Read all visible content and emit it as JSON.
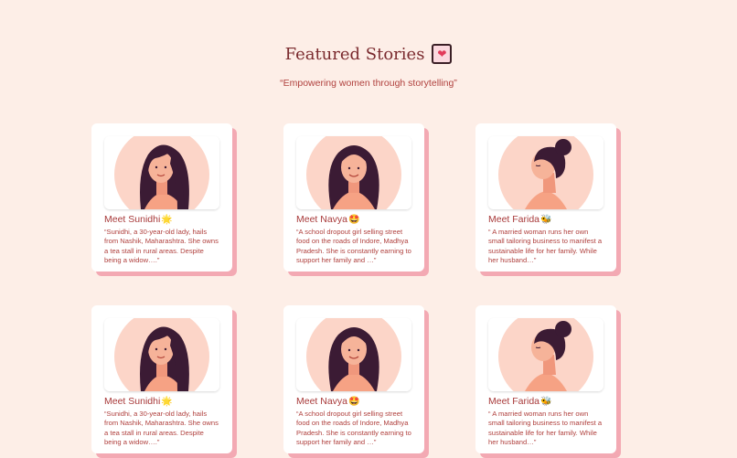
{
  "header": {
    "title": "Featured Stories",
    "subtitle": "“Empowering women through storytelling”",
    "title_icon": "heart-icon"
  },
  "cards": [
    {
      "name": "Meet Sunidhi",
      "emoji": "🌟",
      "avatar": "woman-long-hair-icon",
      "description": "“Sunidhi, a 30-year-old lady, hails from Nashik, Maharashtra. She owns a tea stall in rural areas. Despite being a widow….”"
    },
    {
      "name": "Meet Navya",
      "emoji": "🤩",
      "avatar": "woman-smiling-icon",
      "description": "“A school dropout girl selling street food on the roads of Indore, Madhya Pradesh. She is constantly earning to support her family and …”"
    },
    {
      "name": "Meet Farida",
      "emoji": "🐝",
      "avatar": "woman-bun-profile-icon",
      "description": "“ A married woman runs her own small tailoring business to manifest a sustainable life for her family. While her husband…”"
    },
    {
      "name": "Meet Sunidhi",
      "emoji": "🌟",
      "avatar": "woman-long-hair-icon",
      "description": "“Sunidhi, a 30-year-old lady, hails from Nashik, Maharashtra. She owns a tea stall in rural areas. Despite being a widow….”"
    },
    {
      "name": "Meet Navya",
      "emoji": "🤩",
      "avatar": "woman-smiling-icon",
      "description": "“A school dropout girl selling street food on the roads of Indore, Madhya Pradesh. She is constantly earning to support her family and …”"
    },
    {
      "name": "Meet Farida",
      "emoji": "🐝",
      "avatar": "woman-bun-profile-icon",
      "description": "“ A married woman runs her own small tailoring business to manifest a sustainable life for her family. While her husband…”"
    }
  ],
  "colors": {
    "background": "#fdeee7",
    "title": "#7a2a2e",
    "accent_text": "#b0413e",
    "card_shadow": "#f3a9b3",
    "hair": "#3b1b34",
    "skin": "#f6a284"
  }
}
